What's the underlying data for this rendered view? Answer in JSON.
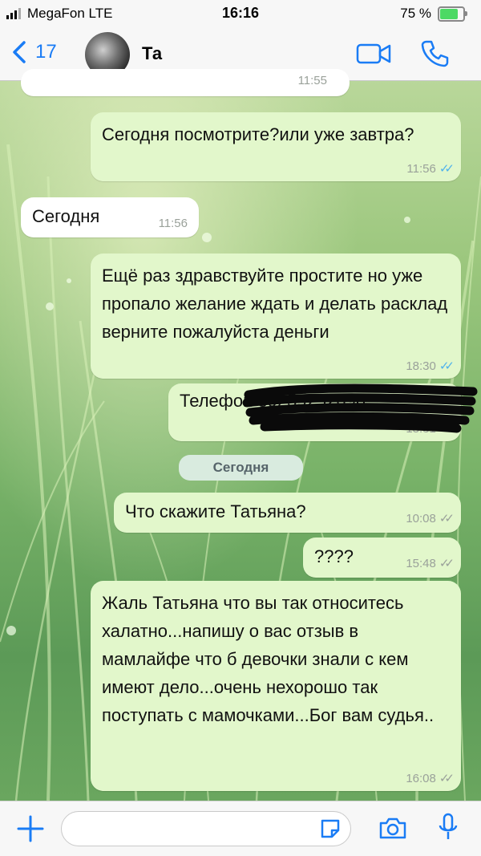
{
  "status_bar": {
    "carrier": "MegaFon  LTE",
    "time": "16:16",
    "battery": "75 %"
  },
  "header": {
    "back_count": "17",
    "contact_name": "Та",
    "icons": [
      "back-chevron-icon",
      "video-call-icon",
      "phone-icon"
    ]
  },
  "messages": [
    {
      "dir": "in",
      "text": "",
      "time": "11:55"
    },
    {
      "dir": "out",
      "text": "Сегодня посмотрите?или уже завтра?",
      "time": "11:56",
      "read": true
    },
    {
      "dir": "in",
      "text": "Сегодня",
      "time": "11:56"
    },
    {
      "dir": "out",
      "text": "Ещё раз здравствуйте простите но уже пропало желание ждать и делать расклад верните пожалуйста деньги",
      "time": "18:30",
      "read": true
    },
    {
      "dir": "out",
      "text": "Телефон 89259252696",
      "time": "18:31",
      "read": true
    },
    {
      "dir": "out",
      "text": "Что скажите Татьяна?",
      "time": "10:08",
      "read": false
    },
    {
      "dir": "out",
      "text": "????",
      "time": "15:48",
      "read": false
    },
    {
      "dir": "out",
      "text": "Жаль Татьяна что вы так относитесь халатно...напишу о вас отзыв в мамлайфе что б девочки знали с кем имеют дело...очень нехорошо так поступать с мамочками...Бог вам судья..",
      "time": "16:08",
      "read": false
    }
  ],
  "date_separator": "Сегодня",
  "input_bar": {
    "placeholder": "",
    "icons": [
      "plus-icon",
      "sticker-icon",
      "camera-icon",
      "microphone-icon"
    ]
  },
  "colors": {
    "outgoing_bubble": "#e2f7cb",
    "incoming_bubble": "#ffffff",
    "accent": "#1a7cf5",
    "read_ticks": "#4fb2ec"
  }
}
